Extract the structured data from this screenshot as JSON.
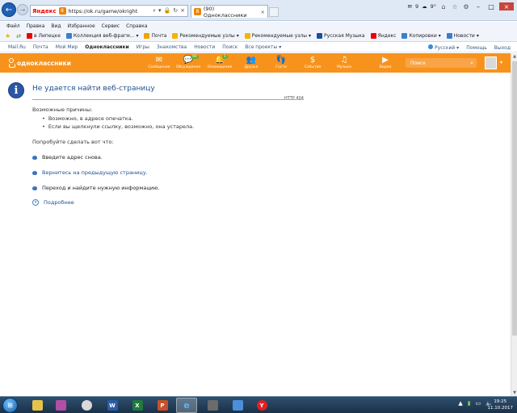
{
  "browser": {
    "address_brand": "Яндекс",
    "url": "https://ok.ru/game/okright",
    "tab_title": "(90) Одноклассники",
    "weather_badge": "9",
    "temp": "9°",
    "menu": [
      "Файл",
      "Правка",
      "Вид",
      "Избранное",
      "Сервис",
      "Справка"
    ],
    "favorites": [
      "в Липецке",
      "Коллекция веб-фрагм...",
      "Почта",
      "Рекомендуемые узлы",
      "Рекомендуемые узлы",
      "Русская Музыка",
      "Яндекс",
      "Копировки",
      "Новости"
    ]
  },
  "ok_nav": {
    "links": [
      "Mail.Ru",
      "Почта",
      "Мой Мир",
      "Одноклассники",
      "Игры",
      "Знакомства",
      "Новости",
      "Поиск",
      "Все проекты"
    ],
    "language": "Русский",
    "help": "Помощь",
    "logout": "Выход"
  },
  "ok_header": {
    "logo": "одноклассники",
    "icons": [
      {
        "label": "Сообщения",
        "glyph": "✉"
      },
      {
        "label": "Обсуждения",
        "glyph": "💬",
        "badge": "90"
      },
      {
        "label": "Оповещения",
        "glyph": "🔔",
        "badge": "1"
      },
      {
        "label": "Друзья",
        "glyph": "👥"
      },
      {
        "label": "Гости",
        "glyph": "👣"
      },
      {
        "label": "События",
        "glyph": "$"
      },
      {
        "label": "Музыка",
        "glyph": "♫"
      },
      {
        "label": "Видео",
        "glyph": "▶"
      }
    ],
    "search_placeholder": "Поиск"
  },
  "error": {
    "title": "Не удается найти веб-страницу",
    "code": "HTTP 404",
    "reasons_heading": "Возможные причины:",
    "reasons": [
      "Возможно, в адресе опечатка.",
      "Если вы щелкнули ссылку, возможно, она устарела."
    ],
    "try_heading": "Попробуйте сделать вот что:",
    "actions": [
      {
        "text": "Введите адрес снова.",
        "link": false
      },
      {
        "text": "Вернитесь на предыдущую страницу.",
        "link": true
      },
      {
        "text": "Переход   и найдите нужную информацию.",
        "link": false
      }
    ],
    "more": "Подробнее"
  },
  "taskbar": {
    "time": "19:25",
    "date": "11.10.2017"
  },
  "colors": {
    "ok_orange": "#f7931d",
    "link_blue": "#1d4f91"
  }
}
